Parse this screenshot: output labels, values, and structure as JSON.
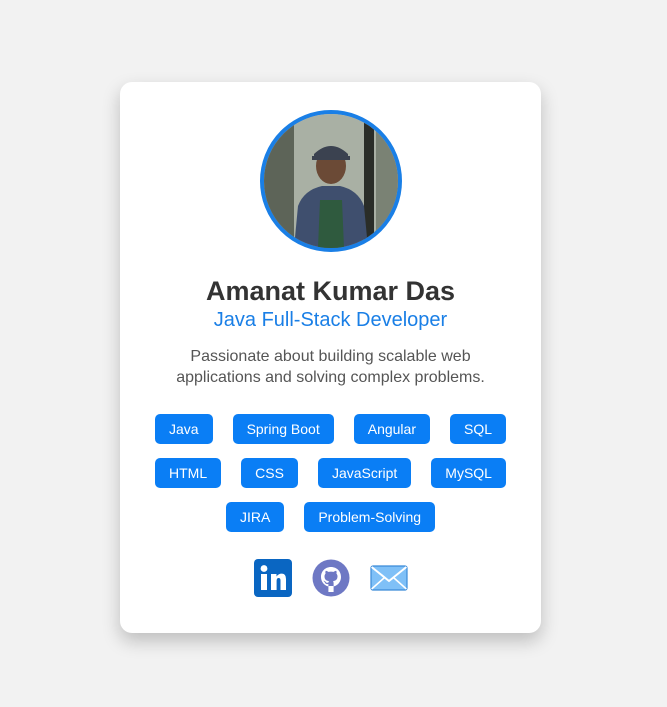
{
  "profile": {
    "name": "Amanat Kumar Das",
    "role": "Java Full-Stack Developer",
    "bio": "Passionate about building scalable web applications and solving complex problems."
  },
  "skills": [
    "Java",
    "Spring Boot",
    "Angular",
    "SQL",
    "HTML",
    "CSS",
    "JavaScript",
    "MySQL",
    "JIRA",
    "Problem-Solving"
  ],
  "social": [
    {
      "icon": "linkedin-icon",
      "label": "LinkedIn"
    },
    {
      "icon": "github-icon",
      "label": "GitHub"
    },
    {
      "icon": "email-icon",
      "label": "Email"
    }
  ],
  "colors": {
    "accent": "#1a7fe6",
    "chip": "#0a7ef5",
    "linkedin": "#0a66c2",
    "github": "#6e78c4",
    "background": "#f2f2f2"
  }
}
